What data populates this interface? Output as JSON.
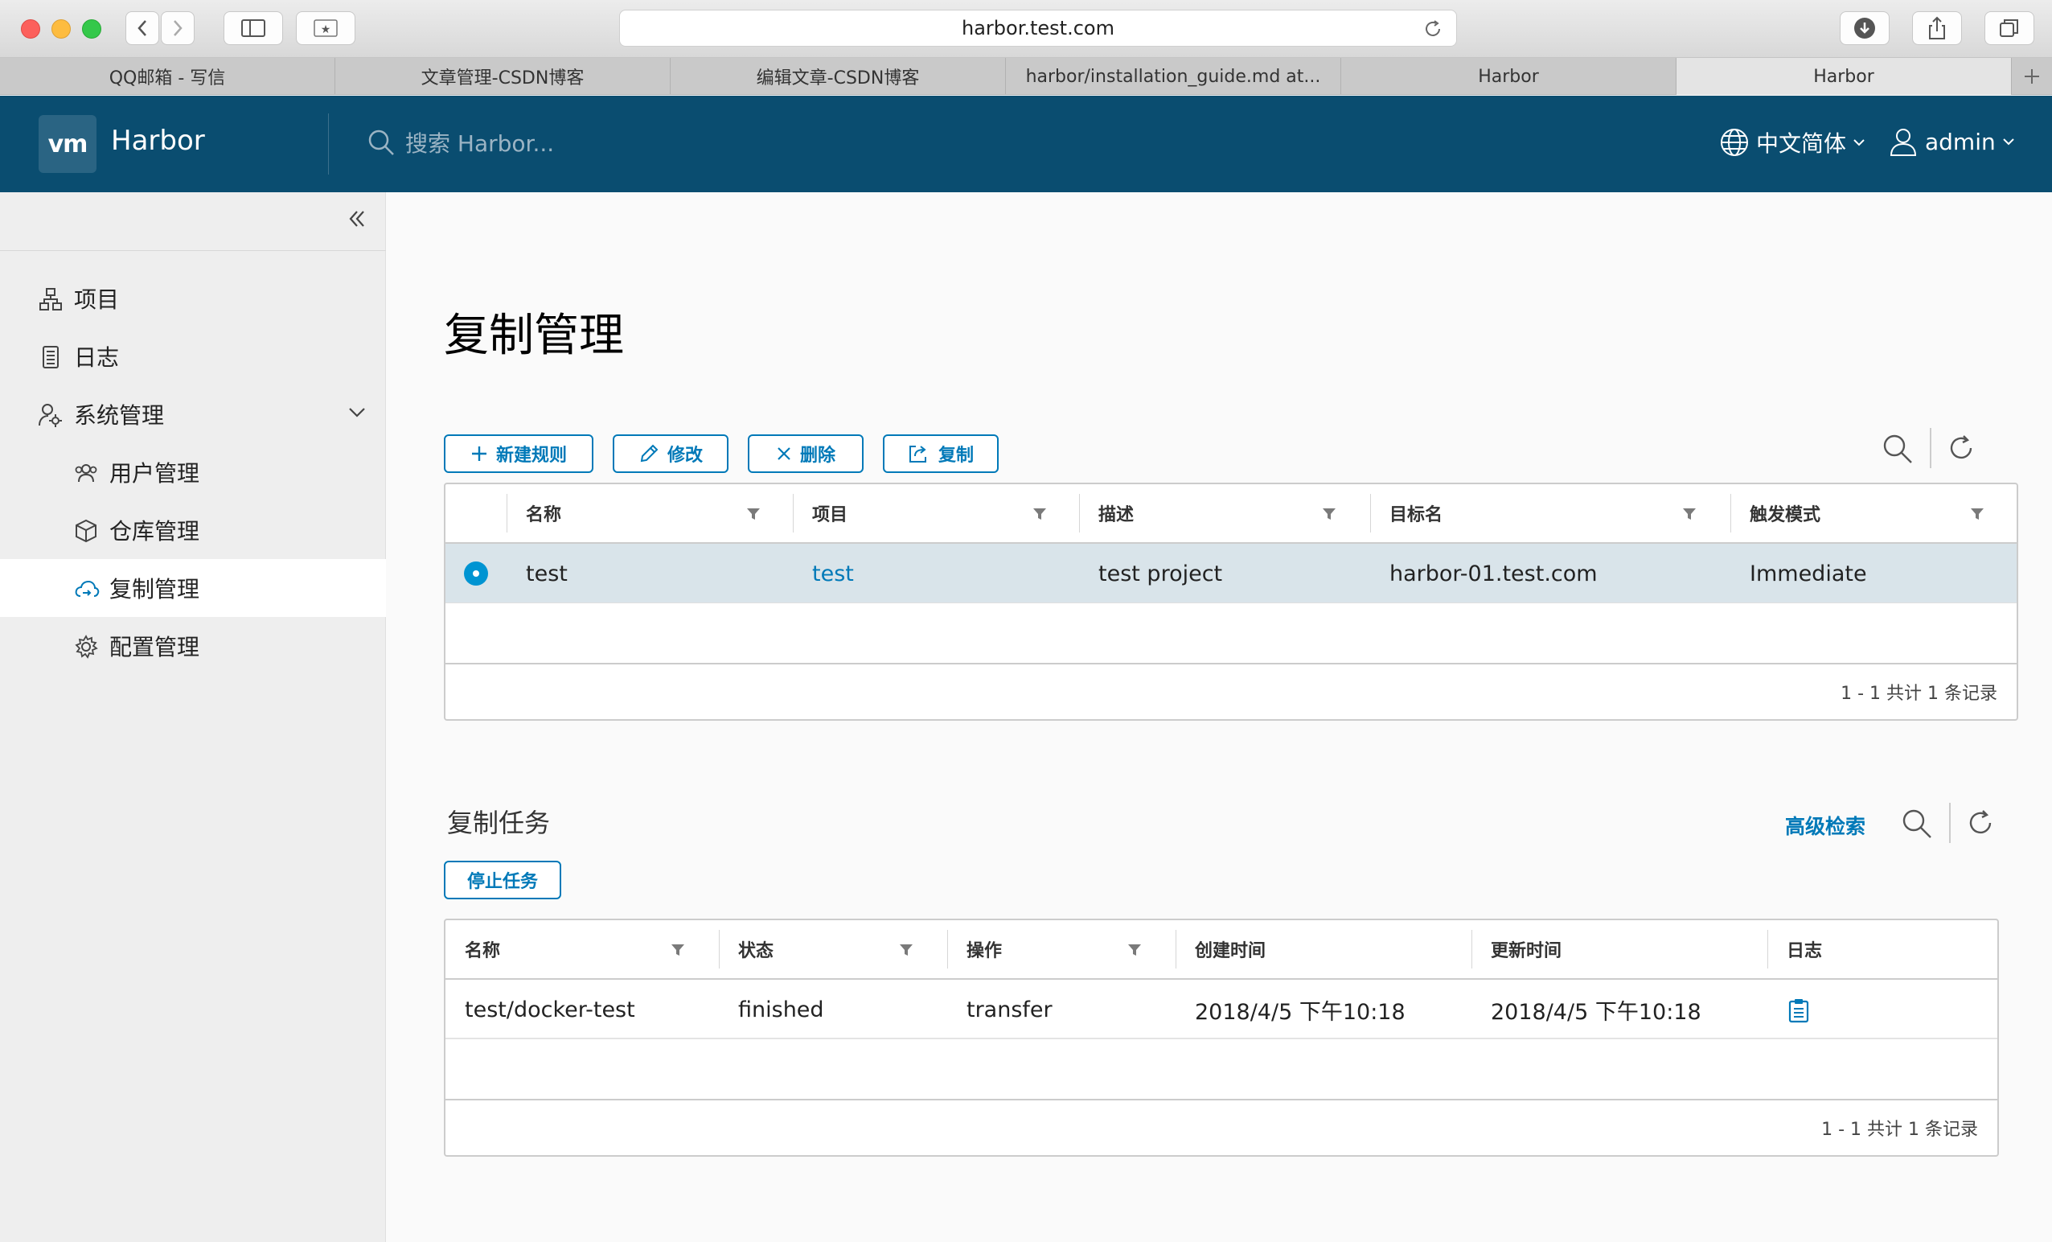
{
  "browser": {
    "url": "harbor.test.com",
    "tabs": [
      {
        "label": "QQ邮箱 - 写信",
        "active": false
      },
      {
        "label": "文章管理-CSDN博客",
        "active": false
      },
      {
        "label": "编辑文章-CSDN博客",
        "active": false
      },
      {
        "label": "harbor/installation_guide.md at...",
        "active": false
      },
      {
        "label": "Harbor",
        "active": false
      },
      {
        "label": "Harbor",
        "active": true
      }
    ]
  },
  "header": {
    "logo": "vm",
    "brand": "Harbor",
    "search_placeholder": "搜索 Harbor...",
    "language": "中文简体",
    "user": "admin",
    "bg_color": "#0a4d70"
  },
  "sidebar": {
    "items": [
      {
        "label": "项目",
        "icon": "project-icon"
      },
      {
        "label": "日志",
        "icon": "log-icon"
      },
      {
        "label": "系统管理",
        "icon": "admin-icon",
        "expanded": true
      }
    ],
    "sub_items": [
      {
        "label": "用户管理",
        "icon": "users-icon"
      },
      {
        "label": "仓库管理",
        "icon": "registry-icon"
      },
      {
        "label": "复制管理",
        "icon": "replication-icon",
        "selected": true
      },
      {
        "label": "配置管理",
        "icon": "config-icon"
      }
    ]
  },
  "main": {
    "title": "复制管理",
    "toolbar": {
      "new_rule": "新建规则",
      "edit": "修改",
      "delete": "删除",
      "replicate": "复制"
    },
    "rules_table": {
      "columns": [
        "名称",
        "项目",
        "描述",
        "目标名",
        "触发模式"
      ],
      "rows": [
        {
          "selected": true,
          "name": "test",
          "project": "test",
          "description": "test project",
          "target": "harbor-01.test.com",
          "trigger": "Immediate"
        }
      ],
      "footer": "1 - 1 共计 1 条记录"
    },
    "jobs": {
      "title": "复制任务",
      "advanced_search": "高级检索",
      "stop_button": "停止任务",
      "columns": [
        "名称",
        "状态",
        "操作",
        "创建时间",
        "更新时间",
        "日志"
      ],
      "rows": [
        {
          "name": "test/docker-test",
          "status": "finished",
          "operation": "transfer",
          "created": "2018/4/5 下午10:18",
          "updated": "2018/4/5 下午10:18",
          "log_icon": "clipboard-icon"
        }
      ],
      "footer": "1 - 1 共计 1 条记录"
    },
    "accent_color": "#0079b8"
  }
}
